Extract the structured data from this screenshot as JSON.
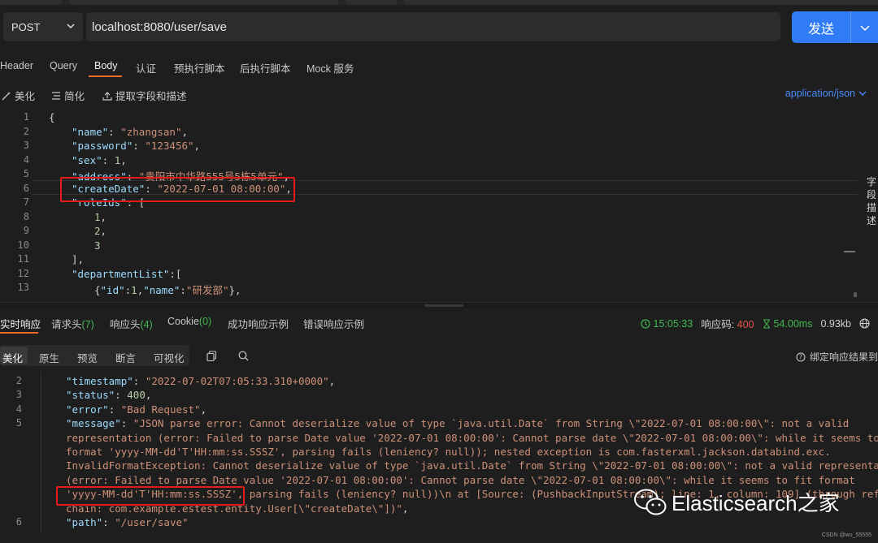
{
  "request": {
    "method": "POST",
    "url": "localhost:8080/user/save",
    "send_label": "发送"
  },
  "request_tabs": [
    "Header",
    "Query",
    "Body",
    "认证",
    "预执行脚本",
    "后执行脚本",
    "Mock 服务"
  ],
  "toolbar": {
    "beautify": "美化",
    "simplify": "简化",
    "extract": "提取字段和描述",
    "content_type": "application/json"
  },
  "side_label": "字段描述",
  "editor": {
    "line_numbers": [
      "1",
      "2",
      "3",
      "4",
      "5",
      "6",
      "7",
      "8",
      "9",
      "10",
      "11",
      "12",
      "13"
    ],
    "lines": [
      {
        "parts": [
          {
            "t": "{",
            "c": "p"
          }
        ]
      },
      {
        "parts": [
          {
            "t": "\"name\"",
            "c": "k"
          },
          {
            "t": ": ",
            "c": "p"
          },
          {
            "t": "\"zhangsan\"",
            "c": "s"
          },
          {
            "t": ",",
            "c": "p"
          }
        ]
      },
      {
        "parts": [
          {
            "t": "\"password\"",
            "c": "k"
          },
          {
            "t": ": ",
            "c": "p"
          },
          {
            "t": "\"123456\"",
            "c": "s"
          },
          {
            "t": ",",
            "c": "p"
          }
        ]
      },
      {
        "parts": [
          {
            "t": "\"sex\"",
            "c": "k"
          },
          {
            "t": ": ",
            "c": "p"
          },
          {
            "t": "1",
            "c": "n"
          },
          {
            "t": ",",
            "c": "p"
          }
        ]
      },
      {
        "parts": [
          {
            "t": "\"address\"",
            "c": "k"
          },
          {
            "t": ": ",
            "c": "p"
          },
          {
            "t": "\"贵阳市中华路555号5栋5单元\"",
            "c": "s"
          },
          {
            "t": ",",
            "c": "p"
          }
        ]
      },
      {
        "parts": [
          {
            "t": "\"createDate\"",
            "c": "k"
          },
          {
            "t": ": ",
            "c": "p"
          },
          {
            "t": "\"2022-07-01 08:00:00\"",
            "c": "s"
          },
          {
            "t": ",",
            "c": "p"
          }
        ]
      },
      {
        "parts": [
          {
            "t": "\"roleIds\"",
            "c": "k"
          },
          {
            "t": ": [",
            "c": "p"
          }
        ]
      },
      {
        "parts": [
          {
            "t": "1",
            "c": "n"
          },
          {
            "t": ",",
            "c": "p"
          }
        ]
      },
      {
        "parts": [
          {
            "t": "2",
            "c": "n"
          },
          {
            "t": ",",
            "c": "p"
          }
        ]
      },
      {
        "parts": [
          {
            "t": "3",
            "c": "n"
          }
        ]
      },
      {
        "parts": [
          {
            "t": "],",
            "c": "p"
          }
        ]
      },
      {
        "parts": [
          {
            "t": "\"departmentList\"",
            "c": "k"
          },
          {
            "t": ":[",
            "c": "p"
          }
        ]
      },
      {
        "parts": [
          {
            "t": "{",
            "c": "p"
          },
          {
            "t": "\"id\"",
            "c": "k"
          },
          {
            "t": ":",
            "c": "p"
          },
          {
            "t": "1",
            "c": "n"
          },
          {
            "t": ",",
            "c": "p"
          },
          {
            "t": "\"name\"",
            "c": "k"
          },
          {
            "t": ":",
            "c": "p"
          },
          {
            "t": "\"研发部\"",
            "c": "s"
          },
          {
            "t": "},",
            "c": "p"
          }
        ]
      }
    ]
  },
  "response_tabs": [
    {
      "label": "实时响应",
      "count": ""
    },
    {
      "label": "请求头",
      "count": "(7)"
    },
    {
      "label": "响应头",
      "count": "(4)"
    },
    {
      "label": "Cookie",
      "count": "(0)"
    },
    {
      "label": "成功响应示例",
      "count": ""
    },
    {
      "label": "错误响应示例",
      "count": ""
    }
  ],
  "response_stats": {
    "time": "15:05:33",
    "status_label": "响应码:",
    "status_code": "400",
    "duration": "54.00ms",
    "size": "0.93kb"
  },
  "view_modes": [
    "美化",
    "原生",
    "预览",
    "断言",
    "可视化"
  ],
  "bind_label": "绑定响应结果到",
  "response": {
    "line_numbers": [
      "2",
      "3",
      "4",
      "5",
      "",
      "",
      "",
      "",
      "",
      "",
      "6"
    ],
    "lines": [
      [
        {
          "t": "\"timestamp\"",
          "c": "k"
        },
        {
          "t": ": ",
          "c": "p"
        },
        {
          "t": "\"2022-07-02T07:05:33.310+0000\"",
          "c": "s"
        },
        {
          "t": ",",
          "c": "p"
        }
      ],
      [
        {
          "t": "\"status\"",
          "c": "k"
        },
        {
          "t": ": ",
          "c": "p"
        },
        {
          "t": "400",
          "c": "n"
        },
        {
          "t": ",",
          "c": "p"
        }
      ],
      [
        {
          "t": "\"error\"",
          "c": "k"
        },
        {
          "t": ": ",
          "c": "p"
        },
        {
          "t": "\"Bad Request\"",
          "c": "s"
        },
        {
          "t": ",",
          "c": "p"
        }
      ],
      [
        {
          "t": "\"message\"",
          "c": "k"
        },
        {
          "t": ": ",
          "c": "p"
        },
        {
          "t": "\"JSON parse error: Cannot deserialize value of type `java.util.Date` from String \\\"2022-07-01 08:00:00\\\": not a valid",
          "c": "s"
        }
      ],
      [
        {
          "t": "representation (error: Failed to parse Date value '2022-07-01 08:00:00': Cannot parse date \\\"2022-07-01 08:00:00\\\": while it seems to fit",
          "c": "s"
        }
      ],
      [
        {
          "t": "format 'yyyy-MM-dd'T'HH:mm:ss.SSSZ', parsing fails (leniency? null)); nested exception is com.fasterxml.jackson.databind.exc.",
          "c": "s"
        }
      ],
      [
        {
          "t": "InvalidFormatException: Cannot deserialize value of type `java.util.Date` from String \\\"2022-07-01 08:00:00\\\": not a valid representation",
          "c": "s"
        }
      ],
      [
        {
          "t": "(error: Failed to parse Date value '2022-07-01 08:00:00': Cannot parse date \\\"2022-07-01 08:00:00\\\": while it seems to fit format",
          "c": "s"
        }
      ],
      [
        {
          "t": "'yyyy-MM-dd'T'HH:mm:ss.SSSZ', parsing fails (leniency? null))\\n at [Source: (PushbackInputStream); line: 1, column: 109] (through reference",
          "c": "s"
        }
      ],
      [
        {
          "t": "chain: com.example.estest.entity.User[\\\"createDate\\\"])\"",
          "c": "s"
        },
        {
          "t": ",",
          "c": "p"
        }
      ],
      [
        {
          "t": "\"path\"",
          "c": "k"
        },
        {
          "t": ": ",
          "c": "p"
        },
        {
          "t": "\"/user/save\"",
          "c": "s"
        }
      ]
    ]
  },
  "watermark": "Elasticsearch之家",
  "credit": "CSDN @wu_55555",
  "colors": {
    "accent": "#f06a2a",
    "send": "#2f7cf6",
    "link": "#4a8cf7",
    "success": "#3fb950",
    "error": "#e5534b",
    "annotation": "#e31b1b"
  }
}
